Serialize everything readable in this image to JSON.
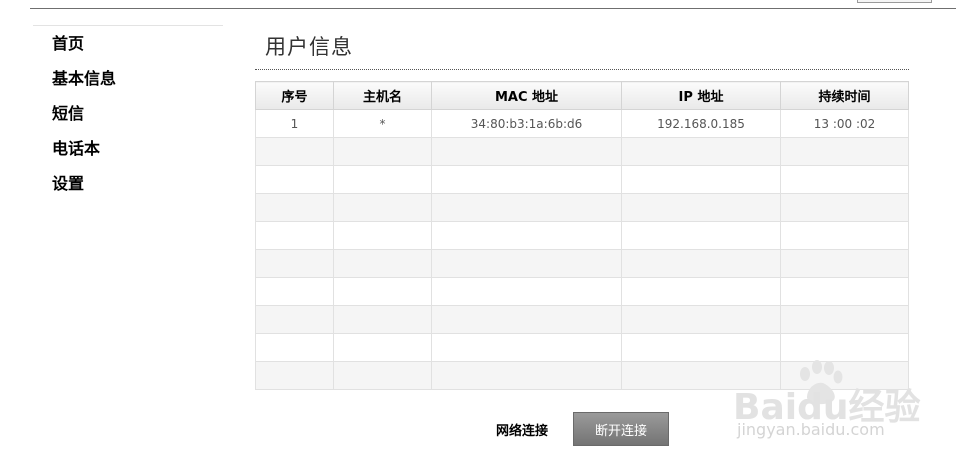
{
  "sidebar": {
    "items": [
      {
        "label": "首页"
      },
      {
        "label": "基本信息"
      },
      {
        "label": "短信"
      },
      {
        "label": "电话本"
      },
      {
        "label": "设置"
      }
    ]
  },
  "main": {
    "title": "用户信息",
    "table": {
      "columns": [
        "序号",
        "主机名",
        "MAC 地址",
        "IP 地址",
        "持续时间"
      ],
      "rows": [
        [
          "1",
          "*",
          "34:80:b3:1a:6b:d6",
          "192.168.0.185",
          "13 :00 :02"
        ],
        [
          "",
          "",
          "",
          "",
          ""
        ],
        [
          "",
          "",
          "",
          "",
          ""
        ],
        [
          "",
          "",
          "",
          "",
          ""
        ],
        [
          "",
          "",
          "",
          "",
          ""
        ],
        [
          "",
          "",
          "",
          "",
          ""
        ],
        [
          "",
          "",
          "",
          "",
          ""
        ],
        [
          "",
          "",
          "",
          "",
          ""
        ],
        [
          "",
          "",
          "",
          "",
          ""
        ],
        [
          "",
          "",
          "",
          "",
          ""
        ]
      ]
    }
  },
  "footer": {
    "network_label": "网络连接",
    "disconnect_label": "断开连接"
  },
  "watermark": {
    "logo": "Baidu经验",
    "url": "jingyan.baidu.com",
    "icon": "paw-icon"
  }
}
